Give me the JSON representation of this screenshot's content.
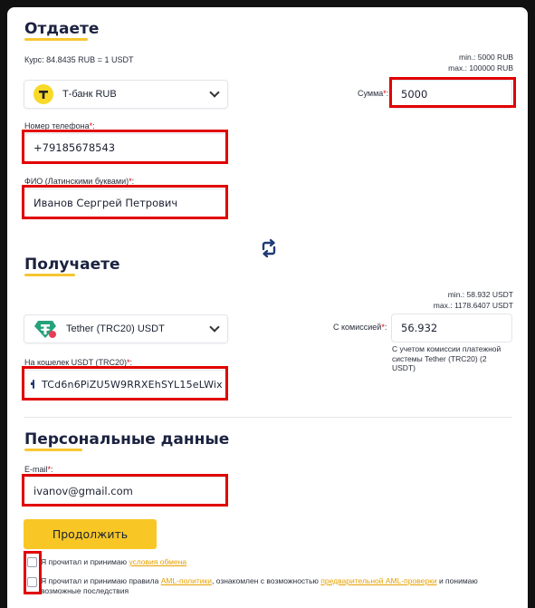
{
  "give": {
    "title": "Отдаете",
    "rate": "Курс: 84.8435 RUB = 1 USDT",
    "min": "min.: 5000 RUB",
    "max": "max.: 100000 RUB",
    "currency": "Т-банк RUB",
    "amount_label": "Сумма",
    "amount_value": "5000",
    "phone_label": "Номер телефона",
    "phone_value": "+79185678543",
    "fio_label": "ФИО (Латинскими буквами)",
    "fio_value": "Иванов Сергрей Петрович"
  },
  "receive": {
    "title": "Получаете",
    "min": "min.: 58.932 USDT",
    "max": "max.: 1178.6407 USDT",
    "currency": "Tether (TRC20) USDT",
    "commission_label": "С комиссией",
    "commission_value": "56.932",
    "commission_note": "С учетом комиссии платежной системы Tether (TRC20) (2 USDT)",
    "wallet_label": "На кошелек USDT (TRC20)",
    "wallet_value": "TCd6n6PiZU5W9RRXEhSYL15eLWix"
  },
  "personal": {
    "title": "Персональные данные",
    "email_label": "E-mail",
    "email_value": "ivanov@gmail.com"
  },
  "actions": {
    "continue_label": "Продолжить"
  },
  "agreements": {
    "terms_prefix": "Я прочитал и принимаю ",
    "terms_link": "условия обмена",
    "aml_prefix": "Я прочитал и принимаю правила ",
    "aml_link": "AML-политики",
    "aml_middle": ", ознакомлен с возможностью ",
    "aml_link2": "предварительной AML-проверки",
    "aml_suffix": " и понимаю возможные последствия"
  },
  "colors": {
    "accent": "#f8c726",
    "highlight": "#e10000",
    "tether": "#26a17b"
  }
}
